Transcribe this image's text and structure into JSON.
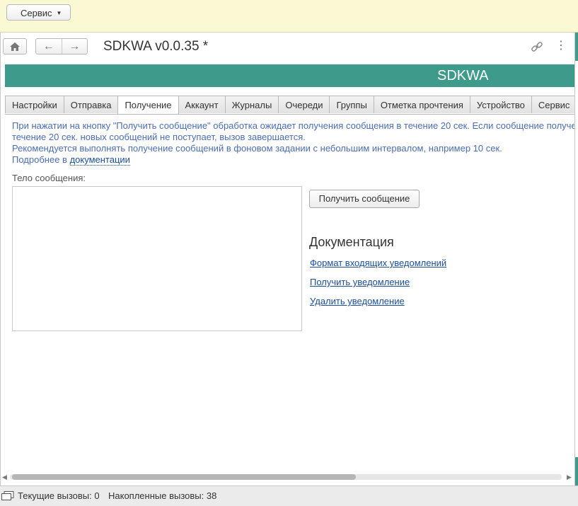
{
  "topbar": {
    "service_label": "Сервис"
  },
  "header": {
    "title": "SDKWA v0.0.35 *"
  },
  "banner": {
    "text": "SDKWA"
  },
  "tabs": [
    {
      "label": "Настройки"
    },
    {
      "label": "Отправка"
    },
    {
      "label": "Получение",
      "active": true
    },
    {
      "label": "Аккаунт"
    },
    {
      "label": "Журналы"
    },
    {
      "label": "Очереди"
    },
    {
      "label": "Группы"
    },
    {
      "label": "Отметка прочтения"
    },
    {
      "label": "Устройство"
    },
    {
      "label": "Сервис"
    }
  ],
  "info": {
    "line1": "При нажатии на кнопку \"Получить сообщение\" обработка ожидает  получения сообщения в течение 20 сек. Если сообщение получено",
    "line2": "течение 20 сек. новых сообщений не поступает, вызов завершается.",
    "line3": "Рекомендуется выполнять получение сообщений в фоновом задании с небольшим интервалом, например 10 сек.",
    "line4_prefix": "Подробнее в ",
    "line4_link": "документации"
  },
  "form": {
    "body_label": "Тело  сообщения:",
    "body_value": "",
    "get_button": "Получить сообщение"
  },
  "docs": {
    "heading": "Документация",
    "links": [
      "Формат входящих уведомлений",
      "Получить уведомление",
      "Удалить уведомление"
    ]
  },
  "status": {
    "current_calls": "Текущие вызовы: 0",
    "accumulated_calls": "Накопленные вызовы: 38"
  },
  "colors": {
    "accent": "#3e9a8b",
    "topbar_bg": "#fbf9d4",
    "info_text": "#4a6db5",
    "link": "#1a4e9a"
  },
  "icons": [
    "home-icon",
    "back-arrow-icon",
    "forward-arrow-icon",
    "link-icon",
    "more-icon",
    "status-windows-icon"
  ]
}
